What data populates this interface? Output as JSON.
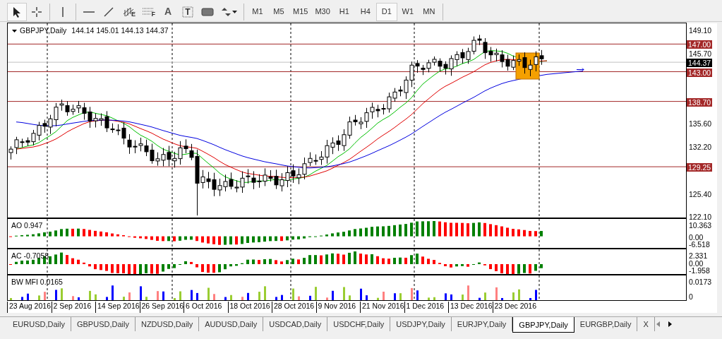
{
  "toolbar": {
    "tools": [
      {
        "kind": "cursor",
        "selected": true
      },
      {
        "kind": "crosshair",
        "selected": false
      },
      {
        "kind": "vline",
        "selected": false
      },
      {
        "kind": "hline",
        "selected": false
      },
      {
        "kind": "trendline",
        "selected": false
      },
      {
        "kind": "channel",
        "label": "E",
        "selected": false
      },
      {
        "kind": "fibo",
        "label": "F",
        "selected": false
      },
      {
        "kind": "text",
        "label": "A",
        "selected": false
      },
      {
        "kind": "textlabel",
        "label": "T",
        "selected": false
      },
      {
        "kind": "rectangle",
        "selected": false
      },
      {
        "kind": "arrows",
        "selected": false
      }
    ],
    "timeframes": [
      {
        "label": "M1",
        "selected": false
      },
      {
        "label": "M5",
        "selected": false
      },
      {
        "label": "M15",
        "selected": false
      },
      {
        "label": "M30",
        "selected": false
      },
      {
        "label": "H1",
        "selected": false
      },
      {
        "label": "H4",
        "selected": false
      },
      {
        "label": "D1",
        "selected": true
      },
      {
        "label": "W1",
        "selected": false
      },
      {
        "label": "MN",
        "selected": false
      }
    ]
  },
  "chart": {
    "title": "GBPJPY,Daily",
    "ohlc": "144.14 145.01 144.13 144.37",
    "price_ticks": [
      "149.10",
      "145.70",
      "135.60",
      "132.20",
      "125.40",
      "122.10"
    ],
    "levels": [
      {
        "label": "147.00"
      },
      {
        "label": "143.00"
      },
      {
        "label": "138.70"
      },
      {
        "label": "129.25"
      }
    ],
    "current_price": "144.37"
  },
  "indicators": [
    {
      "kind": "ao",
      "label": "AO 0.947",
      "ticks": [
        "10.363",
        "0.00",
        "-6.518"
      ]
    },
    {
      "kind": "ac",
      "label": "AC -0.7058",
      "ticks": [
        "2.331",
        "0.00",
        "-1.958"
      ]
    },
    {
      "kind": "mfi",
      "label": "BW MFI 0.0165",
      "ticks": [
        "0.0173",
        "0"
      ]
    }
  ],
  "dates": [
    "23 Aug 2016",
    "2 Sep 2016",
    "14 Sep 2016",
    "26 Sep 2016",
    "6 Oct 2016",
    "18 Oct 2016",
    "28 Oct 2016",
    "9 Nov 2016",
    "21 Nov 2016",
    "1 Dec 2016",
    "13 Dec 2016",
    "23 Dec 2016"
  ],
  "tabs": [
    {
      "label": "EURUSD,Daily",
      "selected": false
    },
    {
      "label": "GBPUSD,Daily",
      "selected": false
    },
    {
      "label": "NZDUSD,Daily",
      "selected": false
    },
    {
      "label": "AUDUSD,Daily",
      "selected": false
    },
    {
      "label": "USDCAD,Daily",
      "selected": false
    },
    {
      "label": "USDCHF,Daily",
      "selected": false
    },
    {
      "label": "USDJPY,Daily",
      "selected": false
    },
    {
      "label": "EURJPY,Daily",
      "selected": false
    },
    {
      "label": "GBPJPY,Daily",
      "selected": true
    },
    {
      "label": "EURGBP,Daily",
      "selected": false
    },
    {
      "label": "X",
      "selected": false
    }
  ]
}
